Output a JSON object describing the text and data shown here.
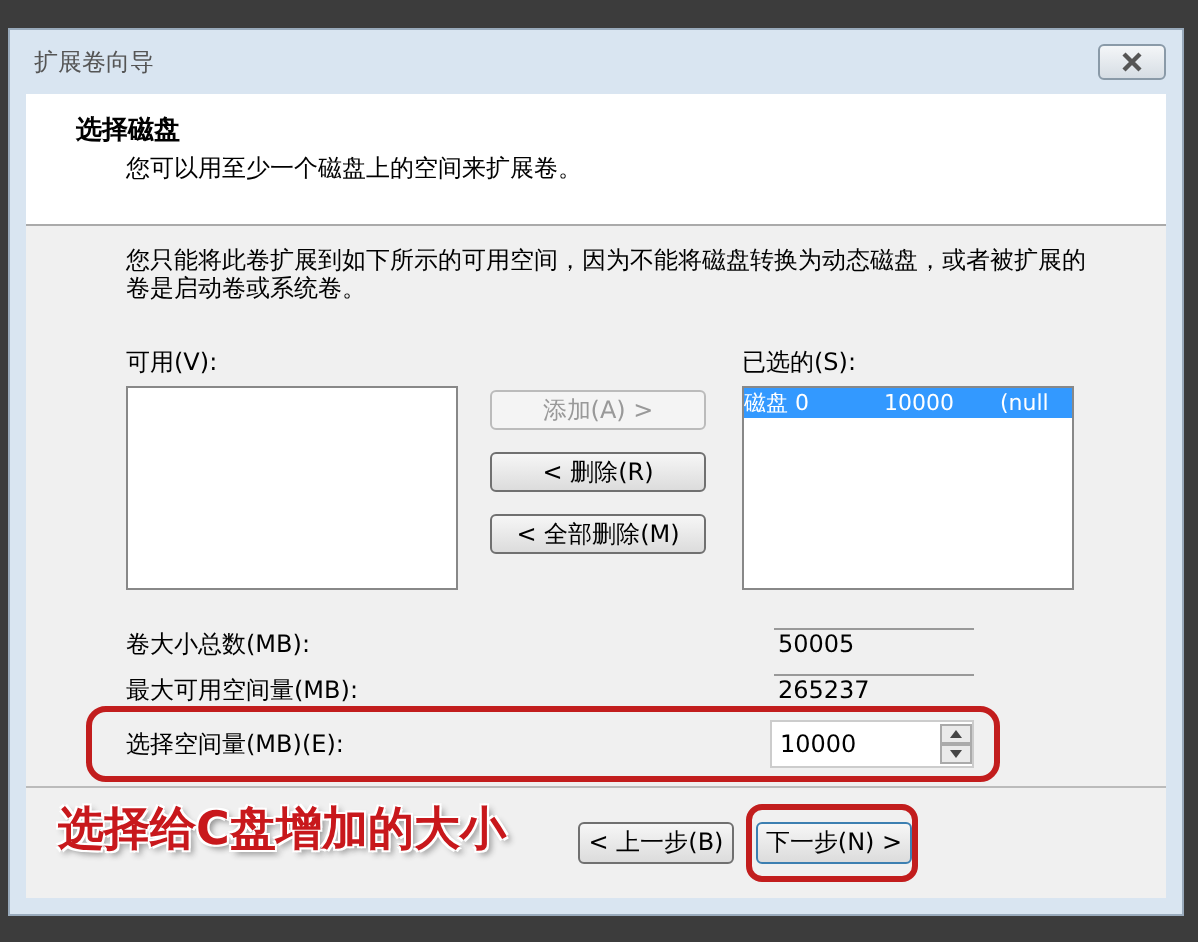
{
  "window": {
    "title": "扩展卷向导"
  },
  "header": {
    "title": "选择磁盘",
    "subtitle": "您可以用至少一个磁盘上的空间来扩展卷。"
  },
  "instruction": "您只能将此卷扩展到如下所示的可用空间，因为不能将磁盘转换为动态磁盘，或者被扩展的卷是启动卷或系统卷。",
  "available": {
    "label": "可用(V):"
  },
  "move_buttons": [
    {
      "label": "添加(A) >",
      "disabled": true
    },
    {
      "label": "< 删除(R)",
      "disabled": false
    },
    {
      "label": "< 全部删除(M)",
      "disabled": false
    }
  ],
  "selected_list": {
    "label": "已选的(S):",
    "items": [
      {
        "disk": "磁盘 0",
        "size": "10000",
        "name": "(null",
        "selected": true
      }
    ]
  },
  "fields": [
    {
      "kind": "readonly",
      "label": "卷大小总数(MB):",
      "value": "50005"
    },
    {
      "kind": "readonly",
      "label": "最大可用空间量(MB):",
      "value": "265237"
    },
    {
      "kind": "spinner",
      "label": "选择空间量(MB)(E):",
      "value": "10000",
      "highlighted": true
    }
  ],
  "nav_buttons": [
    {
      "label": "< 上一步(B)",
      "default": false,
      "highlighted": false
    },
    {
      "label": "下一步(N) >",
      "default": true,
      "highlighted": true
    }
  ],
  "annotation": {
    "caption": "选择给C盘增加的大小"
  }
}
